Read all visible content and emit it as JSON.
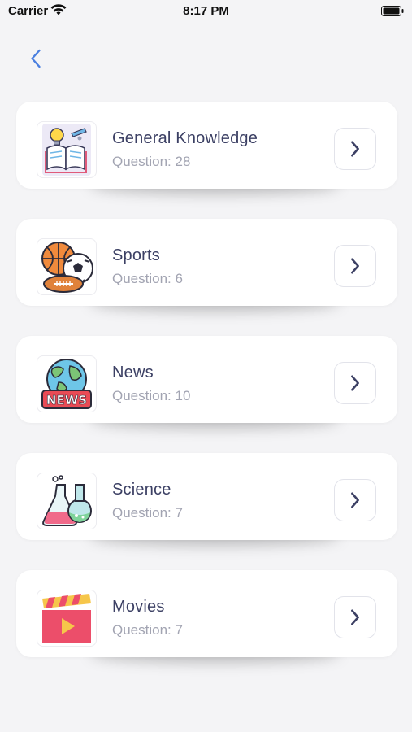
{
  "status_bar": {
    "carrier": "Carrier",
    "time": "8:17 PM"
  },
  "categories": [
    {
      "title": "General Knowledge",
      "subtitle": "Question: 28",
      "icon": "book-lightbulb-icon"
    },
    {
      "title": "Sports",
      "subtitle": "Question: 6",
      "icon": "sports-balls-icon"
    },
    {
      "title": "News",
      "subtitle": "Question: 10",
      "icon": "globe-news-icon"
    },
    {
      "title": "Science",
      "subtitle": "Question: 7",
      "icon": "flasks-icon"
    },
    {
      "title": "Movies",
      "subtitle": "Question: 7",
      "icon": "clapperboard-icon"
    }
  ],
  "news_badge_text": "NEWS",
  "colors": {
    "accent": "#4a7fe0",
    "title": "#3c4064",
    "subtitle": "#a2a4b2",
    "chevron": "#3c4064"
  }
}
